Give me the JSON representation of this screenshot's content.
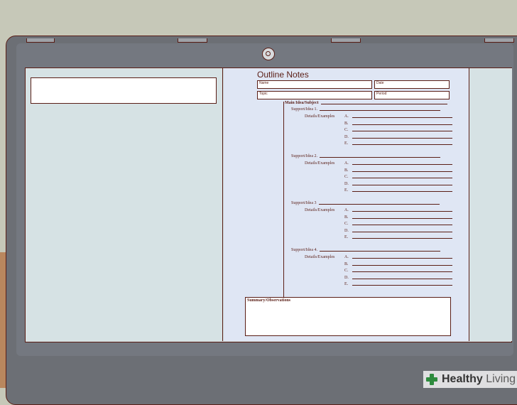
{
  "document": {
    "title": "Outline Notes",
    "fields": {
      "name": "Name",
      "date": "Date",
      "topic": "Topic",
      "period": "Period"
    },
    "main_idea_label": "Main Idea/Subject",
    "sections": [
      {
        "support_label": "Support/Idea 1.",
        "details_label": "Details/Examples",
        "letters": [
          "A.",
          "B.",
          "C.",
          "D.",
          "E."
        ]
      },
      {
        "support_label": "Support/Idea 2.",
        "details_label": "Details/Examples",
        "letters": [
          "A.",
          "B.",
          "C.",
          "D.",
          "E."
        ]
      },
      {
        "support_label": "Support/Idea 3",
        "details_label": "Details/Examples",
        "letters": [
          "A.",
          "B.",
          "C.",
          "D.",
          "E."
        ]
      },
      {
        "support_label": "Support/Idea 4.",
        "details_label": "Details/Examples",
        "letters": [
          "A.",
          "B.",
          "C.",
          "D.",
          "E."
        ]
      }
    ],
    "summary_label": "Summary/Observations"
  },
  "watermark": {
    "brand_prefix": "Healthy",
    "brand_suffix": "Living",
    "accent_color": "#2e8b3e"
  },
  "colors": {
    "outline": "#5a1e16",
    "laptop_body": "#6c6f75",
    "screen_bg": "#cfdadd",
    "document_bg": "#dfe6f4"
  }
}
